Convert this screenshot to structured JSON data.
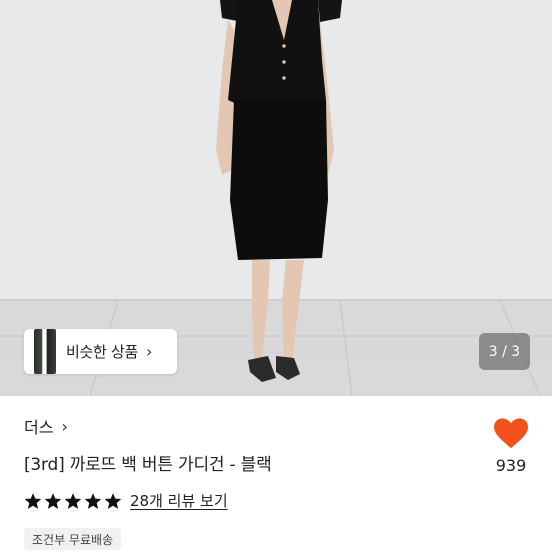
{
  "gallery": {
    "similar_button_label": "비슷한 상품",
    "page_counter": "3 / 3"
  },
  "product": {
    "shop_name": "더스",
    "title": "[3rd] 까로뜨 백 버튼 가디건 - 블랙",
    "like_count": "939",
    "rating": 5,
    "review_link_label": "28개 리뷰 보기",
    "shipping_badge": "조건부 무료배송"
  },
  "colors": {
    "like_heart": "#f4511e",
    "stars": "#111111"
  }
}
